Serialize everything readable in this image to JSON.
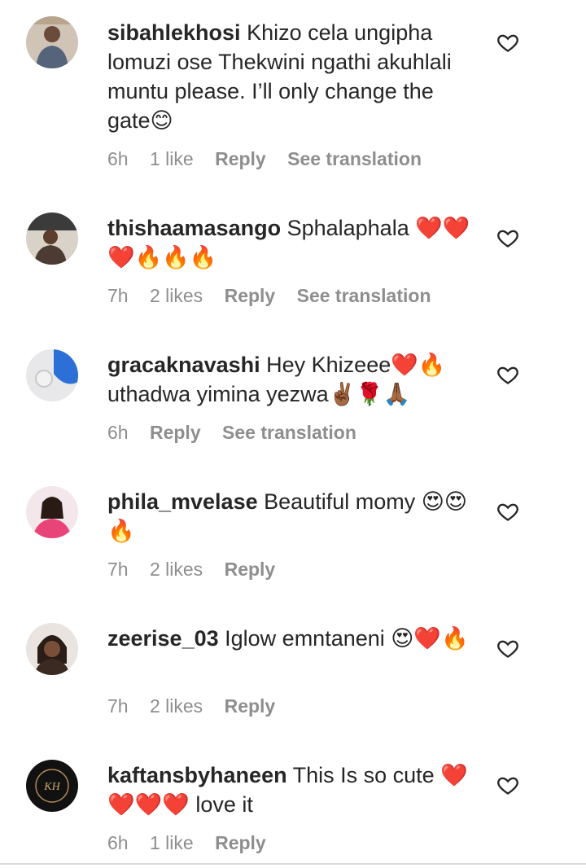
{
  "comments": [
    {
      "username": "sibahlekhosi",
      "text": "Khizo cela ungipha lomuzi ose Thekwini ngathi akuhlali muntu please. I’ll only change the gate😊",
      "time": "6h",
      "likes": "1 like",
      "reply": "Reply",
      "translate": "See translation",
      "avatar_color": "#b9a48e"
    },
    {
      "username": "thishaamasango",
      "text": "Sphalaphala ❤️❤️❤️🔥🔥🔥",
      "time": "7h",
      "likes": "2 likes",
      "reply": "Reply",
      "translate": "See translation",
      "avatar_color": "#7a6a5a"
    },
    {
      "username": "gracaknavashi",
      "text": "Hey Khizeee❤️🔥 uthadwa yimina yezwa✌🏾🌹🙏🏾",
      "time": "6h",
      "likes": "",
      "reply": "Reply",
      "translate": "See translation",
      "avatar_color": "#2c6fd6"
    },
    {
      "username": "phila_mvelase",
      "text": "Beautiful momy 😍😍🔥",
      "time": "7h",
      "likes": "2 likes",
      "reply": "Reply",
      "translate": "",
      "avatar_color": "#e8447a"
    },
    {
      "username": "zeerise_03",
      "text": "Iglow emntaneni 😍❤️🔥",
      "time": "7h",
      "likes": "2 likes",
      "reply": "Reply",
      "translate": "",
      "avatar_color": "#3a2a22"
    },
    {
      "username": "kaftansbyhaneen",
      "text": "This Is so cute ❤️❤️❤️❤️ love it",
      "time": "6h",
      "likes": "1 like",
      "reply": "Reply",
      "translate": "",
      "avatar_color": "#111111",
      "avatar_monogram": "KH"
    }
  ]
}
